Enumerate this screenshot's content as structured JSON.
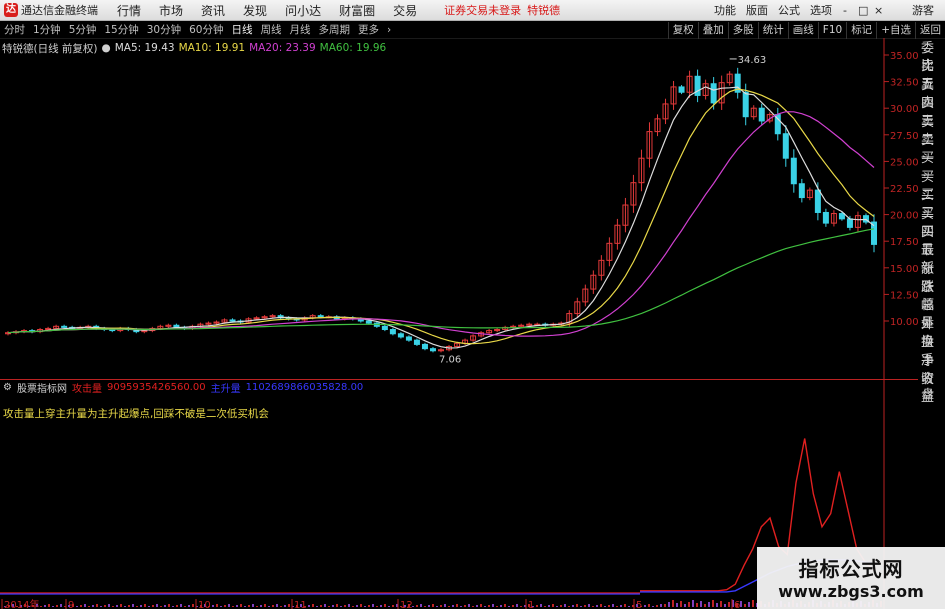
{
  "app": {
    "title": "通达信金融终端",
    "logo_char": "达"
  },
  "menu": {
    "items": [
      "行情",
      "市场",
      "资讯",
      "发现",
      "问小达",
      "财富圈",
      "交易"
    ],
    "warning": "证券交易未登录",
    "stock": "特锐德",
    "right": [
      "功能",
      "版面",
      "公式",
      "选项"
    ],
    "guest": "游客",
    "win_min": "-",
    "win_max": "□",
    "win_close": "×"
  },
  "toolbar": {
    "periods": [
      "分时",
      "1分钟",
      "5分钟",
      "15分钟",
      "30分钟",
      "60分钟",
      "日线",
      "周线",
      "月线",
      "多周期",
      "更多"
    ],
    "active": "日线",
    "right": [
      "复权",
      "叠加",
      "多股",
      "统计",
      "画线",
      "F10",
      "标记",
      "+自选",
      "返回"
    ]
  },
  "legend": {
    "title": "特锐德(日线 前复权)",
    "ma5": "MA5: 19.43",
    "ma10": "MA10: 19.91",
    "ma20": "MA20: 23.39",
    "ma60": "MA60: 19.96"
  },
  "colors": {
    "up": "#e23a3a",
    "down": "#3ad2e6",
    "ma5": "#dcdcdc",
    "ma10": "#e8d848",
    "ma20": "#d040d0",
    "ma60": "#40c040",
    "attack": "#e02020",
    "main": "#3838ff"
  },
  "sidebar": [
    "委比",
    "卖五",
    "卖四",
    "卖三",
    "卖二",
    "卖一",
    "买一",
    "买二",
    "买三",
    "买四",
    "买五",
    "最新",
    "涨跌",
    "涨幅",
    "总量",
    "外盘",
    "换手",
    "净资",
    "收益"
  ],
  "sidebar_icon": "盘",
  "indicator": {
    "name": "股票指标网",
    "attack_label": "攻击量",
    "attack_value": "9095935426560.00",
    "main_label": "主升量",
    "main_value": "1102689866035828.00",
    "note": "攻击量上穿主升量为主升起爆点,回踩不破是二次低买机会"
  },
  "chart_data": {
    "type": "candlestick",
    "price_axis": {
      "ticks": [
        35.0,
        32.5,
        30.0,
        27.5,
        25.0,
        22.5,
        20.0,
        17.5,
        15.0,
        12.5,
        10.0
      ],
      "labels": [
        "35.00",
        "32.50",
        "30.00",
        "27.50",
        "25.00",
        "22.50",
        "20.00",
        "17.50",
        "15.00",
        "12.50",
        "10.00"
      ]
    },
    "annotations": {
      "high": "34.63",
      "low": "7.06"
    },
    "x_labels": [
      "2014年",
      "9",
      "10",
      "11",
      "12",
      "1",
      "5",
      "6"
    ],
    "close": [
      8.9,
      9.0,
      9.1,
      9.0,
      9.2,
      9.3,
      9.5,
      9.4,
      9.3,
      9.4,
      9.5,
      9.3,
      9.2,
      9.1,
      9.3,
      9.2,
      9.0,
      9.1,
      9.3,
      9.5,
      9.6,
      9.4,
      9.3,
      9.5,
      9.7,
      9.8,
      9.9,
      10.1,
      10.0,
      9.9,
      10.2,
      10.3,
      10.4,
      10.5,
      10.3,
      10.2,
      10.1,
      10.3,
      10.5,
      10.4,
      10.4,
      10.2,
      10.3,
      10.2,
      10.0,
      9.8,
      9.5,
      9.2,
      8.8,
      8.5,
      8.2,
      7.8,
      7.4,
      7.2,
      7.3,
      7.6,
      7.9,
      8.2,
      8.6,
      8.9,
      9.1,
      9.2,
      9.4,
      9.5,
      9.6,
      9.7,
      9.7,
      9.6,
      9.7,
      9.8,
      10.7,
      11.8,
      13.0,
      14.3,
      15.7,
      17.3,
      19.0,
      20.9,
      23.0,
      25.3,
      27.8,
      29.0,
      30.4,
      32.0,
      31.5,
      33.0,
      31.2,
      32.3,
      30.5,
      32.4,
      33.2,
      31.5,
      29.2,
      30.0,
      28.8,
      29.4,
      27.6,
      25.3,
      22.9,
      21.6,
      22.3,
      20.2,
      19.2,
      20.1,
      19.6,
      18.8,
      19.9,
      19.3,
      17.2
    ],
    "indicator_series": {
      "attack": [
        2,
        2,
        2,
        2,
        2,
        2,
        2,
        2,
        2,
        2,
        3,
        8,
        25,
        40,
        60,
        68,
        42,
        35,
        100,
        140,
        90,
        60,
        72,
        110,
        75,
        40,
        28,
        20
      ],
      "main": [
        1,
        1,
        1,
        1,
        1,
        1,
        1,
        1,
        1,
        1,
        1,
        2,
        6,
        10,
        14,
        18,
        21,
        24,
        26,
        28,
        29,
        30,
        30,
        30,
        30,
        29,
        28,
        27
      ]
    }
  }
}
